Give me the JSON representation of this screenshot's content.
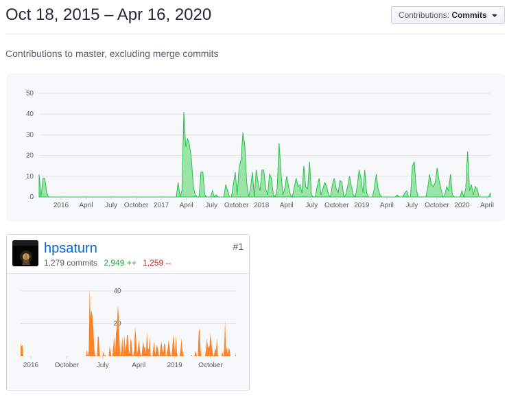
{
  "header": {
    "date_range": "Oct 18, 2015 – Apr 16, 2020",
    "contributions_label": "Contributions:",
    "contributions_value": "Commits"
  },
  "subtitle": "Contributions to master, excluding merge commits",
  "colors": {
    "main_fill": "#9be4a8",
    "main_stroke": "#2cbe4e",
    "user_fill": "#f9822b",
    "link": "#0366d6",
    "additions": "#28a745",
    "deletions": "#cb2431"
  },
  "chart_data": [
    {
      "type": "area",
      "y_ticks": [
        "0",
        "10",
        "20",
        "30",
        "40",
        "50"
      ],
      "ylim": [
        0,
        50
      ],
      "x_ticks": [
        "2016",
        "April",
        "July",
        "October",
        "2017",
        "April",
        "July",
        "October",
        "2018",
        "April",
        "July",
        "October",
        "2019",
        "April",
        "July",
        "October",
        "2020",
        "April"
      ],
      "x": [
        "2015-10-18",
        "2015-10-25",
        "2015-11-01",
        "2015-11-08",
        "2015-11-15",
        "2015-11-22",
        "2015-11-29",
        "2015-12-06",
        "2015-12-13",
        "2015-12-20",
        "2015-12-27",
        "2016-01-03",
        "2016-01-10",
        "2016-01-17",
        "2016-01-24",
        "2016-01-31",
        "2016-02-07",
        "2016-02-14",
        "2016-02-21",
        "2016-02-28",
        "2016-03-06",
        "2016-03-13",
        "2016-03-20",
        "2016-03-27",
        "2016-04-03",
        "2016-04-10",
        "2016-04-17",
        "2016-04-24",
        "2016-05-01",
        "2016-05-08",
        "2016-05-15",
        "2016-05-22",
        "2016-05-29",
        "2016-06-05",
        "2016-06-12",
        "2016-06-19",
        "2016-06-26",
        "2016-07-03",
        "2016-07-10",
        "2016-07-17",
        "2016-07-24",
        "2016-07-31",
        "2016-08-07",
        "2016-08-14",
        "2016-08-21",
        "2016-08-28",
        "2016-09-04",
        "2016-09-11",
        "2016-09-18",
        "2016-09-25",
        "2016-10-02",
        "2016-10-09",
        "2016-10-16",
        "2016-10-23",
        "2016-10-30",
        "2016-11-06",
        "2016-11-13",
        "2016-11-20",
        "2016-11-27",
        "2016-12-04",
        "2016-12-11",
        "2016-12-18",
        "2016-12-25",
        "2017-01-01",
        "2017-01-08",
        "2017-01-15",
        "2017-01-22",
        "2017-01-29",
        "2017-02-05",
        "2017-02-12",
        "2017-02-19",
        "2017-02-26",
        "2017-03-05",
        "2017-03-12",
        "2017-03-19",
        "2017-03-26",
        "2017-04-02",
        "2017-04-09",
        "2017-04-16",
        "2017-04-23",
        "2017-04-30",
        "2017-05-07",
        "2017-05-14",
        "2017-05-21",
        "2017-05-28",
        "2017-06-04",
        "2017-06-11",
        "2017-06-18",
        "2017-06-25",
        "2017-07-02",
        "2017-07-09",
        "2017-07-16",
        "2017-07-23",
        "2017-07-30",
        "2017-08-06",
        "2017-08-13",
        "2017-08-20",
        "2017-08-27",
        "2017-09-03",
        "2017-09-10",
        "2017-09-17",
        "2017-09-24",
        "2017-10-01",
        "2017-10-08",
        "2017-10-15",
        "2017-10-22",
        "2017-10-29",
        "2017-11-05",
        "2017-11-12",
        "2017-11-19",
        "2017-11-26",
        "2017-12-03",
        "2017-12-10",
        "2017-12-17",
        "2017-12-24",
        "2017-12-31",
        "2018-01-07",
        "2018-01-14",
        "2018-01-21",
        "2018-01-28",
        "2018-02-04",
        "2018-02-11",
        "2018-02-18",
        "2018-02-25",
        "2018-03-04",
        "2018-03-11",
        "2018-03-18",
        "2018-03-25",
        "2018-04-01",
        "2018-04-08",
        "2018-04-15",
        "2018-04-22",
        "2018-04-29",
        "2018-05-06",
        "2018-05-13",
        "2018-05-20",
        "2018-05-27",
        "2018-06-03",
        "2018-06-10",
        "2018-06-17",
        "2018-06-24",
        "2018-07-01",
        "2018-07-08",
        "2018-07-15",
        "2018-07-22",
        "2018-07-29",
        "2018-08-05",
        "2018-08-12",
        "2018-08-19",
        "2018-08-26",
        "2018-09-02",
        "2018-09-09",
        "2018-09-16",
        "2018-09-23",
        "2018-09-30",
        "2018-10-07",
        "2018-10-14",
        "2018-10-21",
        "2018-10-28",
        "2018-11-04",
        "2018-11-11",
        "2018-11-18",
        "2018-11-25",
        "2018-12-02",
        "2018-12-09",
        "2018-12-16",
        "2018-12-23",
        "2018-12-30",
        "2019-01-06",
        "2019-01-13",
        "2019-01-20",
        "2019-01-27",
        "2019-02-03",
        "2019-02-10",
        "2019-02-17",
        "2019-02-24",
        "2019-03-03",
        "2019-03-10",
        "2019-03-17",
        "2019-03-24",
        "2019-03-31",
        "2019-04-07",
        "2019-04-14",
        "2019-04-21",
        "2019-04-28",
        "2019-05-05",
        "2019-05-12",
        "2019-05-19",
        "2019-05-26",
        "2019-06-02",
        "2019-06-09",
        "2019-06-16",
        "2019-06-23",
        "2019-06-30",
        "2019-07-07",
        "2019-07-14",
        "2019-07-21",
        "2019-07-28",
        "2019-08-04",
        "2019-08-11",
        "2019-08-18",
        "2019-08-25",
        "2019-09-01",
        "2019-09-08",
        "2019-09-15",
        "2019-09-22",
        "2019-09-29",
        "2019-10-06",
        "2019-10-13",
        "2019-10-20",
        "2019-10-27",
        "2019-11-03",
        "2019-11-10",
        "2019-11-17",
        "2019-11-24",
        "2019-12-01",
        "2019-12-08",
        "2019-12-15",
        "2019-12-22",
        "2019-12-29",
        "2020-01-05",
        "2020-01-12",
        "2020-01-19",
        "2020-01-26",
        "2020-02-02",
        "2020-02-09",
        "2020-02-16",
        "2020-02-23",
        "2020-03-01",
        "2020-03-08",
        "2020-03-15",
        "2020-03-22",
        "2020-03-29",
        "2020-04-05",
        "2020-04-12"
      ],
      "values": [
        11,
        0,
        9,
        9,
        2,
        0,
        0,
        0,
        0,
        0,
        0,
        0,
        0,
        0,
        0,
        0,
        0,
        0,
        0,
        0,
        0,
        0,
        0,
        0,
        0,
        0,
        0,
        0,
        0,
        0,
        0,
        0,
        0,
        0,
        0,
        0,
        0,
        0,
        0,
        0,
        0,
        0,
        0,
        0,
        0,
        0,
        0,
        0,
        0,
        0,
        0,
        0,
        0,
        0,
        0,
        0,
        0,
        0,
        0,
        0,
        0,
        0,
        0,
        0,
        0,
        0,
        0,
        0,
        0,
        0,
        0,
        0,
        0,
        7,
        0,
        3,
        41,
        24,
        28,
        25,
        18,
        5,
        1,
        0,
        0,
        12,
        12,
        1,
        0,
        0,
        0,
        3,
        0,
        1,
        0,
        0,
        0,
        0,
        6,
        3,
        0,
        0,
        6,
        12,
        1,
        14,
        18,
        31,
        25,
        7,
        0,
        4,
        12,
        0,
        13,
        7,
        3,
        13,
        13,
        4,
        1,
        11,
        9,
        1,
        0,
        4,
        26,
        12,
        1,
        4,
        10,
        5,
        1,
        0,
        5,
        9,
        5,
        6,
        2,
        15,
        5,
        4,
        17,
        1,
        0,
        0,
        5,
        9,
        1,
        4,
        7,
        5,
        1,
        0,
        6,
        9,
        4,
        2,
        8,
        7,
        0,
        1,
        5,
        10,
        5,
        1,
        0,
        5,
        13,
        9,
        2,
        13,
        2,
        0,
        0,
        0,
        4,
        11,
        4,
        1,
        0,
        0,
        0,
        0,
        0,
        0,
        0,
        0,
        1,
        0,
        0,
        0,
        2,
        3,
        0,
        0,
        15,
        17,
        4,
        0,
        0,
        0,
        0,
        0,
        4,
        11,
        6,
        5,
        7,
        14,
        8,
        4,
        0,
        1,
        5,
        3,
        11,
        1,
        0,
        0,
        0,
        0,
        3,
        0,
        4,
        22,
        3,
        6,
        1,
        5,
        4,
        0,
        0,
        0,
        0,
        0,
        0,
        2
      ]
    },
    {
      "type": "area",
      "series_owner": "hpsaturn",
      "y_ticks": [
        "20",
        "40"
      ],
      "ylim": [
        0,
        45
      ],
      "x_ticks": [
        "2016",
        "October",
        "July",
        "April",
        "2019",
        "October"
      ],
      "values": [
        8,
        6,
        7,
        0,
        0,
        0,
        0,
        0,
        0,
        0,
        0,
        0,
        0,
        0,
        0,
        0,
        0,
        0,
        0,
        0,
        0,
        0,
        0,
        0,
        0,
        0,
        0,
        0,
        0,
        0,
        0,
        0,
        0,
        0,
        0,
        0,
        0,
        0,
        0,
        0,
        0,
        0,
        0,
        0,
        0,
        0,
        0,
        0,
        0,
        0,
        0,
        0,
        0,
        0,
        0,
        0,
        0,
        0,
        0,
        0,
        0,
        0,
        0,
        0,
        0,
        0,
        0,
        0,
        0,
        0,
        0,
        0,
        0,
        4,
        0,
        3,
        41,
        24,
        28,
        25,
        18,
        5,
        1,
        0,
        0,
        12,
        12,
        1,
        0,
        0,
        0,
        3,
        0,
        1,
        0,
        0,
        0,
        0,
        6,
        3,
        0,
        0,
        6,
        12,
        1,
        14,
        18,
        31,
        25,
        7,
        0,
        4,
        12,
        0,
        13,
        7,
        3,
        13,
        13,
        4,
        1,
        11,
        9,
        1,
        0,
        4,
        18,
        12,
        1,
        4,
        10,
        5,
        1,
        0,
        5,
        9,
        5,
        6,
        2,
        15,
        5,
        4,
        12,
        1,
        0,
        0,
        5,
        9,
        1,
        4,
        7,
        5,
        1,
        0,
        6,
        9,
        4,
        2,
        8,
        7,
        0,
        1,
        5,
        10,
        5,
        1,
        0,
        5,
        13,
        9,
        2,
        13,
        2,
        0,
        0,
        0,
        4,
        11,
        4,
        1,
        0,
        0,
        0,
        0,
        0,
        0,
        0,
        0,
        1,
        0,
        0,
        0,
        2,
        3,
        0,
        0,
        15,
        17,
        4,
        0,
        0,
        0,
        0,
        0,
        4,
        11,
        6,
        5,
        7,
        14,
        8,
        4,
        0,
        1,
        5,
        3,
        11,
        1,
        0,
        0,
        0,
        0,
        3,
        0,
        4,
        22,
        3,
        6,
        1,
        5,
        4,
        0,
        0,
        0,
        0,
        0,
        0,
        2
      ]
    }
  ],
  "contributor": {
    "name": "hpsaturn",
    "commits": "1,279 commits",
    "additions": "2,949 ++",
    "deletions": "1,259 --",
    "rank": "#1"
  }
}
